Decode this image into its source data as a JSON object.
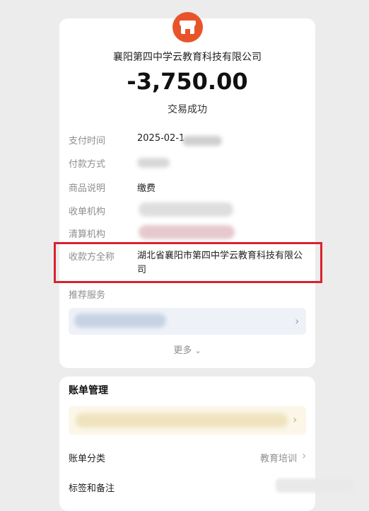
{
  "receipt": {
    "merchant_name": "襄阳第四中学云教育科技有限公司",
    "amount": "-3,750.00",
    "status": "交易成功"
  },
  "details": {
    "pay_time_label": "支付时间",
    "pay_time_value": "2025-02-1",
    "pay_method_label": "付款方式",
    "item_desc_label": "商品说明",
    "item_desc_value": "缴费",
    "acquirer_label": "收单机构",
    "clearing_label": "清算机构",
    "payee_full_name_label": "收款方全称",
    "payee_full_name_value": "湖北省襄阳市第四中学云教育科技有限公司",
    "recommended_label": "推荐服务",
    "more_label": "更多"
  },
  "bill_management": {
    "title": "账单管理",
    "category_label": "账单分类",
    "category_value": "教育培训",
    "tags_label": "标签和备注"
  },
  "colors": {
    "brand_icon": "#e8542a",
    "highlight_border": "#d9232d"
  },
  "icons": [
    "shop-icon",
    "chevron-right-icon",
    "chevron-down-icon"
  ]
}
